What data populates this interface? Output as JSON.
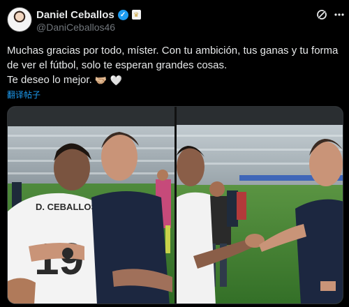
{
  "author": {
    "name": "Daniel Ceballos",
    "handle": "@DaniCeballos46",
    "verified": true,
    "affiliation_badge": "real-madrid-crest-icon"
  },
  "actions": {
    "grok_icon": "grok-icon",
    "more_icon": "more-options-icon"
  },
  "tweet": {
    "line1": "Muchas gracias por todo, míster. Con tu ambición, tus ganas y tu forma",
    "line2": "de ver el fútbol, solo te esperan grandes cosas.",
    "line3": "Te deseo lo mejor.",
    "emojis": [
      "🤝🏼",
      "🤍"
    ],
    "translate_label": "翻译帖子"
  },
  "media": {
    "count": 2,
    "photo_1": {
      "jersey_text": "D. CEBALLOS",
      "jersey_number": "19"
    },
    "photo_2": {
      "description_icon": "handshake-photo"
    }
  },
  "colors": {
    "background": "#000000",
    "text": "#e7e9ea",
    "secondary": "#71767b",
    "link": "#1d9bf0"
  }
}
